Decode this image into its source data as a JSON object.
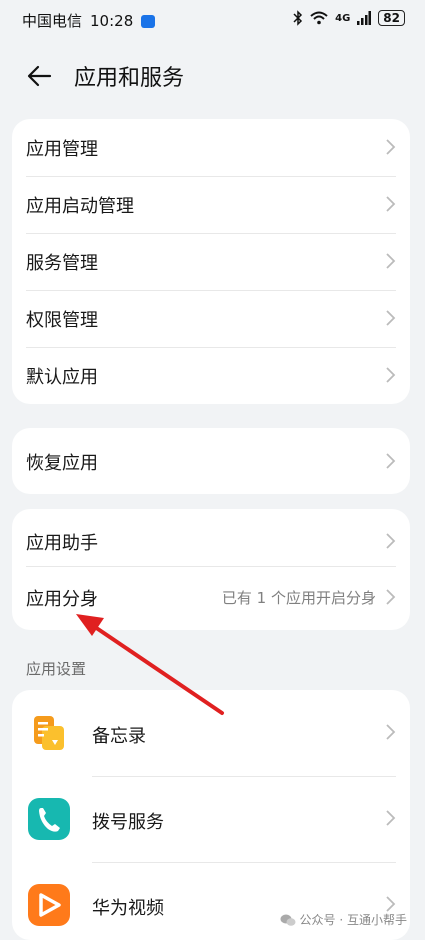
{
  "status_bar": {
    "carrier": "中国电信",
    "time": "10:28",
    "network": "4G",
    "battery": "82"
  },
  "header": {
    "title": "应用和服务"
  },
  "group1": [
    "应用管理",
    "应用启动管理",
    "服务管理",
    "权限管理",
    "默认应用"
  ],
  "group2": [
    "恢复应用"
  ],
  "group3": [
    {
      "label": "应用助手",
      "value": ""
    },
    {
      "label": "应用分身",
      "value": "已有 1 个应用开启分身"
    }
  ],
  "section_title": "应用设置",
  "apps": [
    {
      "label": "备忘录",
      "icon": "memo-icon",
      "color": "#f5a623"
    },
    {
      "label": "拨号服务",
      "icon": "phone-icon",
      "color": "#17b8b0"
    },
    {
      "label": "华为视频",
      "icon": "video-icon",
      "color": "#ff7a1a"
    }
  ],
  "watermark": "公众号 · 互通小帮手",
  "accent_red": "#e02020"
}
